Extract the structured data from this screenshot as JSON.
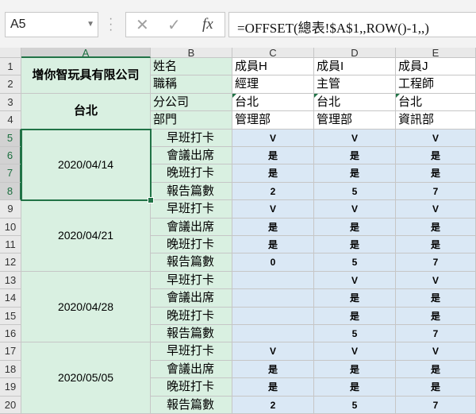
{
  "formula_bar": {
    "name_box": "A5",
    "cancel_icon": "✕",
    "enter_icon": "✓",
    "fx_label": "fx",
    "formula": "=OFFSET(總表!$A$1,,ROW()-1,,)"
  },
  "columns": [
    "A",
    "B",
    "C",
    "D",
    "E"
  ],
  "rows": [
    "1",
    "2",
    "3",
    "4",
    "5",
    "6",
    "7",
    "8",
    "9",
    "10",
    "11",
    "12",
    "13",
    "14",
    "15",
    "16",
    "17",
    "18",
    "19",
    "20"
  ],
  "sheet": {
    "company": "增你智玩具有限公司",
    "branch": "台北",
    "labels": [
      "姓名",
      "職稱",
      "分公司",
      "部門"
    ],
    "header_rows": [
      [
        "成員H",
        "成員I",
        "成員J"
      ],
      [
        "經理",
        "主管",
        "工程師"
      ],
      [
        "台北",
        "台北",
        "台北"
      ],
      [
        "管理部",
        "管理部",
        "資訊部"
      ]
    ],
    "item_labels": [
      "早班打卡",
      "會議出席",
      "晚班打卡",
      "報告篇數"
    ],
    "weeks": [
      {
        "date": "2020/04/14",
        "cells": [
          [
            "V",
            "V",
            "V"
          ],
          [
            "是",
            "是",
            "是"
          ],
          [
            "是",
            "是",
            "是"
          ],
          [
            "2",
            "5",
            "7"
          ]
        ]
      },
      {
        "date": "2020/04/21",
        "cells": [
          [
            "V",
            "V",
            "V"
          ],
          [
            "是",
            "是",
            "是"
          ],
          [
            "是",
            "是",
            "是"
          ],
          [
            "0",
            "5",
            "7"
          ]
        ]
      },
      {
        "date": "2020/04/28",
        "cells": [
          [
            "",
            "V",
            "V"
          ],
          [
            "",
            "是",
            "是"
          ],
          [
            "",
            "是",
            "是"
          ],
          [
            "",
            "5",
            "7"
          ]
        ]
      },
      {
        "date": "2020/05/05",
        "cells": [
          [
            "V",
            "V",
            "V"
          ],
          [
            "是",
            "是",
            "是"
          ],
          [
            "是",
            "是",
            "是"
          ],
          [
            "2",
            "5",
            "7"
          ]
        ]
      }
    ]
  },
  "colors": {
    "green_fill": "#d9f0e1",
    "blue_fill": "#dae8f5",
    "accent": "#217346"
  }
}
